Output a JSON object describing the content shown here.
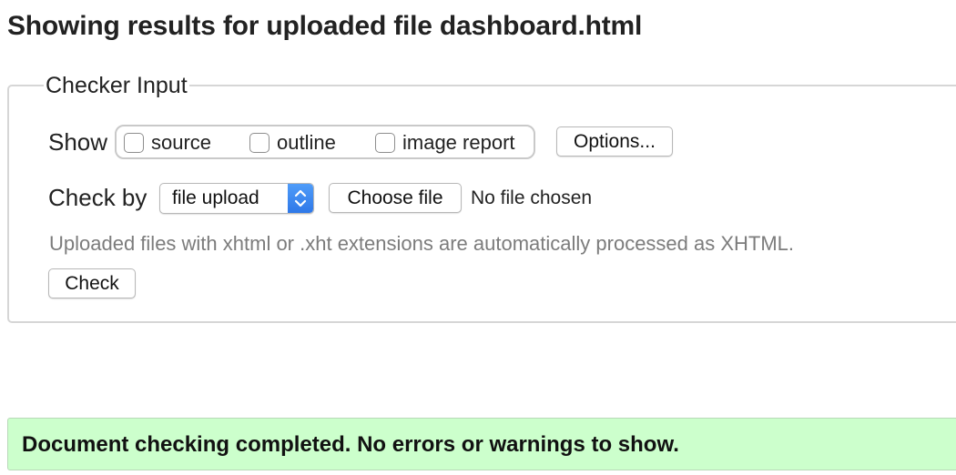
{
  "heading": "Showing results for uploaded file dashboard.html",
  "checker": {
    "legend": "Checker Input",
    "show_label": "Show",
    "checkboxes": [
      {
        "label": "source",
        "checked": false
      },
      {
        "label": "outline",
        "checked": false
      },
      {
        "label": "image report",
        "checked": false
      }
    ],
    "options_button": "Options...",
    "check_by_label": "Check by",
    "check_by_select": {
      "selected": "file upload",
      "icon": "up-down-chevron-icon",
      "accent": "#3b86f0"
    },
    "choose_file_button": "Choose file",
    "no_file_text": "No file chosen",
    "hint": "Uploaded files with xhtml or .xht extensions are automatically processed as XHTML.",
    "check_button": "Check"
  },
  "result": {
    "message": "Document checking completed. No errors or warnings to show.",
    "background": "#ccffcc"
  }
}
